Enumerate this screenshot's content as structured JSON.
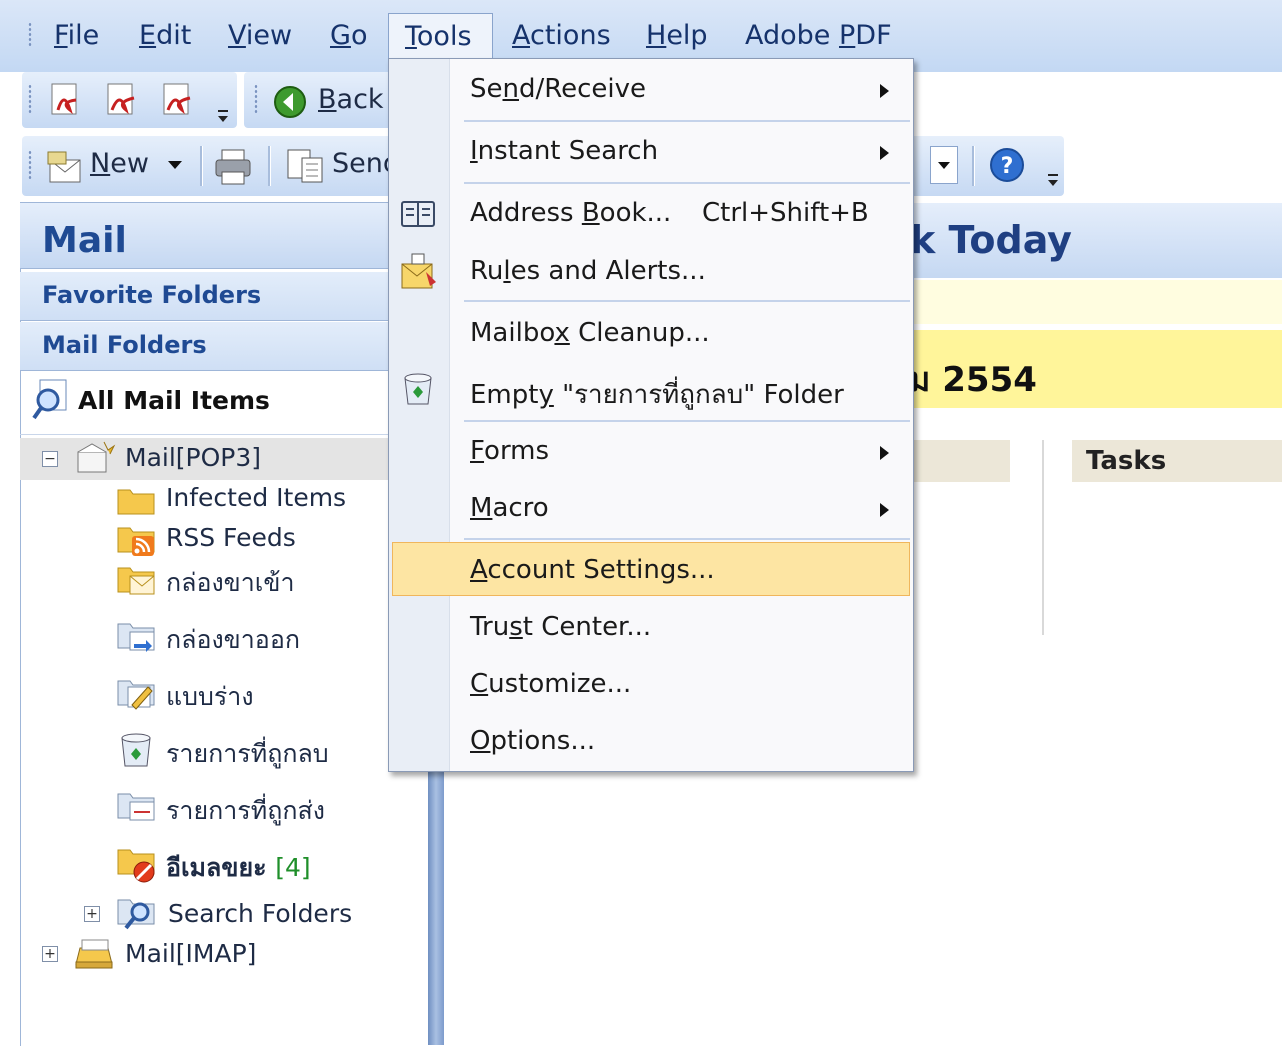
{
  "menubar": {
    "items": [
      "File",
      "Edit",
      "View",
      "Go",
      "Tools",
      "Actions",
      "Help",
      "Adobe PDF"
    ],
    "active": "Tools"
  },
  "toolbar": {
    "back_label": "Back",
    "new_label": "New",
    "send_label": "Send"
  },
  "nav_pane": {
    "title": "Mail",
    "favorite_folders": "Favorite Folders",
    "mail_folders": "Mail Folders",
    "all_mail_items": "All Mail Items",
    "tree": {
      "pop3": "Mail[POP3]",
      "infected": "Infected Items",
      "rss": "RSS Feeds",
      "inbox": "กล่องขาเข้า",
      "outbox": "กล่องขาออก",
      "drafts": "แบบร่าง",
      "deleted": "รายการที่ถูกลบ",
      "sent": "รายการที่ถูกส่ง",
      "junk": "อีเมลขยะ",
      "junk_count": "[4]",
      "search": "Search Folders",
      "imap": "Mail[IMAP]"
    }
  },
  "today": {
    "title_partial": "Today",
    "title_prefix_partial": "k",
    "date_partial": "ม 2554",
    "tasks_label": "Tasks"
  },
  "tools_menu": {
    "send_receive": "Send/Receive",
    "instant_search": "Instant Search",
    "address_book": "Address Book...",
    "address_book_shortcut": "Ctrl+Shift+B",
    "rules": "Rules and Alerts...",
    "mailbox_cleanup": "Mailbox Cleanup...",
    "empty_folder": "Empty \"รายการที่ถูกลบ\" Folder",
    "forms": "Forms",
    "macro": "Macro",
    "account_settings": "Account Settings...",
    "trust_center": "Trust Center...",
    "customize": "Customize...",
    "options": "Options..."
  },
  "colors": {
    "highlight": "#fde5a3",
    "header_blue": "#1f3f82",
    "info_yellow": "#fff59a"
  }
}
